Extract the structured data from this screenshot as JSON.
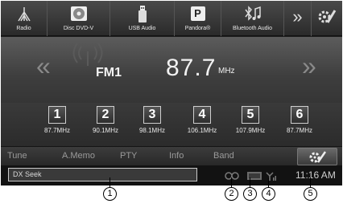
{
  "sources": [
    {
      "label": "Radio",
      "icon": "antenna-icon"
    },
    {
      "label": "Disc DVD-V",
      "icon": "disc-icon"
    },
    {
      "label": "USB Audio",
      "icon": "usb-icon"
    },
    {
      "label": "Pandora®",
      "icon": "pandora-icon"
    },
    {
      "label": "Bluetooth Audio",
      "icon": "bluetooth-audio-icon"
    },
    {
      "label": "",
      "icon": "double-chevron-right-icon"
    },
    {
      "label": "",
      "icon": "setup-tools-icon"
    }
  ],
  "pandora_letter": "P",
  "more_glyph": "»",
  "tuner": {
    "seek_down_glyph": "«",
    "seek_up_glyph": "»",
    "band": "FM1",
    "frequency": "87.7",
    "unit": "MHz"
  },
  "presets": [
    {
      "number": "1",
      "freq": "87.7MHz"
    },
    {
      "number": "2",
      "freq": "90.1MHz"
    },
    {
      "number": "3",
      "freq": "98.1MHz"
    },
    {
      "number": "4",
      "freq": "106.1MHz"
    },
    {
      "number": "5",
      "freq": "107.9MHz"
    },
    {
      "number": "6",
      "freq": "87.7MHz"
    }
  ],
  "functions": [
    "Tune",
    "A.Memo",
    "PTY",
    "Info",
    "Band"
  ],
  "status": {
    "seek_mode": "DX Seek",
    "time": "11:16 AM"
  },
  "callouts": [
    "1",
    "2",
    "3",
    "4",
    "5"
  ],
  "colors": {
    "screen_bg": "#1e1e1e",
    "text_primary": "#f2f2f2",
    "function_text": "#9a9a9a",
    "status_bg": "#121212"
  }
}
